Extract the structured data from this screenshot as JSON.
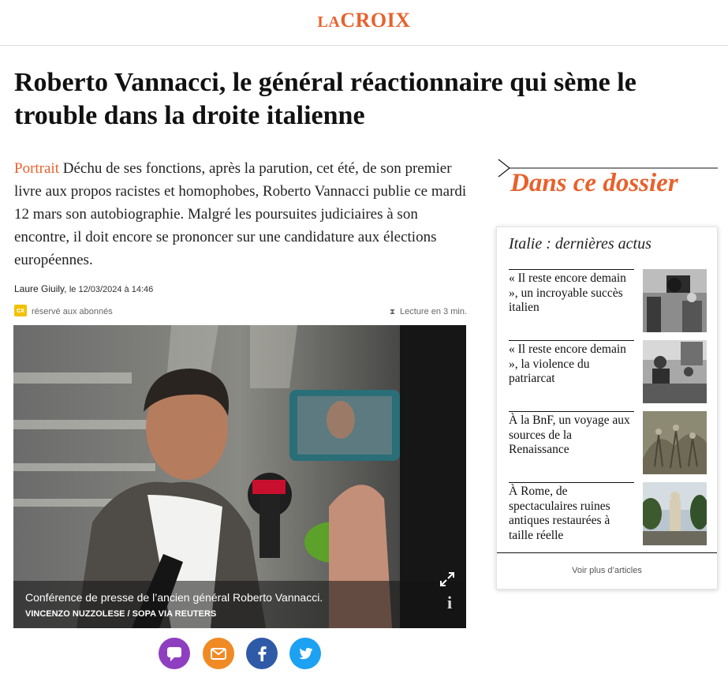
{
  "header": {
    "logo_prefix": "LA",
    "logo_main": "CROIX"
  },
  "article": {
    "title": "Roberto Vannacci, le général réactionnaire qui sème le trouble dans la droite italienne",
    "kicker": "Portrait",
    "lead": "Déchu de ses fonctions, après la parution, cet été, de son premier livre aux propos racistes et homophobes, Roberto Vannacci publie ce mardi 12 mars son autobiographie. Malgré les poursuites judiciaires à son encontre, il doit encore se prononcer sur une candidature aux élections européennes.",
    "author": "Laure Giuily,",
    "date": "le 12/03/2024 à 14:46",
    "badge": "cx",
    "subscribers": "réservé aux abonnés",
    "reading_time": "Lecture en 3 min.",
    "photo_caption": "Conférence de presse de l’ancien général Roberto Vannacci.",
    "photo_credit": "VINCENZO NUZZOLESE / SOPA VIA REUTERS"
  },
  "share": {
    "comment_color": "#8e3fc0",
    "email_color": "#f08a24",
    "facebook_color": "#2f5aa8",
    "twitter_color": "#1da1f2"
  },
  "sidebar": {
    "dossier_title": "Dans ce dossier",
    "card_title": "Italie : dernières actus",
    "items": [
      {
        "text": "« Il reste encore demain », un incroyable succès italien"
      },
      {
        "text": "« Il reste encore demain », la violence du patriarcat"
      },
      {
        "text": "À la BnF, un voyage aux sources de la Renaissance"
      },
      {
        "text": "À Rome, de spectaculaires ruines antiques restaurées à taille réelle"
      }
    ],
    "more_label": "Voir plus d’articles"
  },
  "colors": {
    "accent": "#e8612c"
  }
}
